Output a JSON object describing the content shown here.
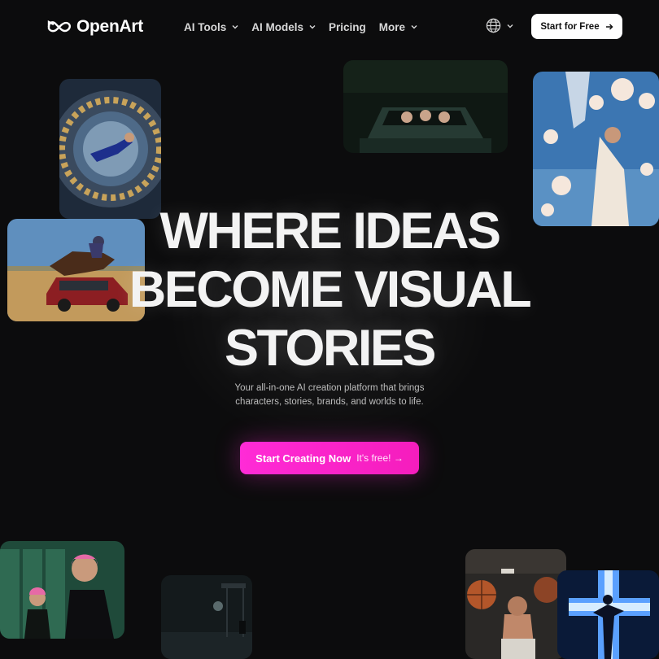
{
  "header": {
    "brand": "OpenArt",
    "nav": [
      {
        "label": "AI Tools",
        "has_dropdown": true
      },
      {
        "label": "AI Models",
        "has_dropdown": true
      },
      {
        "label": "Pricing",
        "has_dropdown": false
      },
      {
        "label": "More",
        "has_dropdown": true
      }
    ],
    "language_icon": "globe-icon",
    "cta_label": "Start for Free",
    "cta_icon": "arrow-right-icon"
  },
  "hero": {
    "title_lines": [
      "WHERE IDEAS",
      "BECOME VISUAL",
      "STORIES"
    ],
    "subtitle": "Your all-in-one AI creation platform that brings characters, stories, brands, and worlds to life.",
    "cta_label": "Start Creating Now",
    "cta_free": "It's free! →"
  },
  "colors": {
    "background": "#0c0c0d",
    "cta_pink": "#ff2bd6",
    "nav_text": "#d8d8d8"
  },
  "gallery": [
    "astronaut-floating-image",
    "car-night-image",
    "flowers-bride-image",
    "horse-jumping-car-image",
    "pink-hair-lockers-image",
    "rainy-street-image",
    "basketball-player-image",
    "cross-light-figure-image"
  ]
}
